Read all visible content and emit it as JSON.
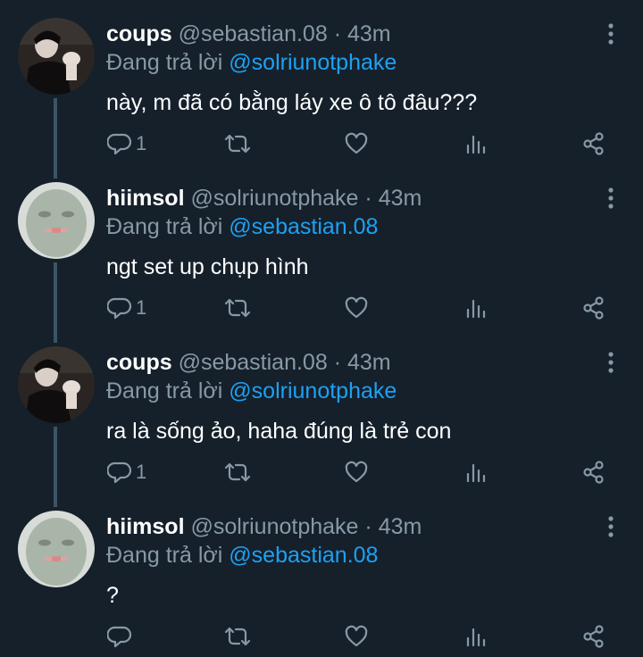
{
  "tweets": [
    {
      "name": "coups",
      "handle": "@sebastian.08",
      "separator": "·",
      "time": "43m",
      "reply_prefix": "Đang trả lời",
      "reply_to": "@solriunotphake",
      "text": "này, m đã có bằng láy xe ô tô đâu???",
      "reply_count": "1",
      "avatar": "coups-avatar"
    },
    {
      "name": "hiimsol",
      "handle": "@solriunotphake",
      "separator": "·",
      "time": "43m",
      "reply_prefix": "Đang trả lời",
      "reply_to": "@sebastian.08",
      "text": "ngt set up chụp hình",
      "reply_count": "1",
      "avatar": "hiimsol-avatar"
    },
    {
      "name": "coups",
      "handle": "@sebastian.08",
      "separator": "·",
      "time": "43m",
      "reply_prefix": "Đang trả lời",
      "reply_to": "@solriunotphake",
      "text": "ra là sống ảo, haha đúng là trẻ con",
      "reply_count": "1",
      "avatar": "coups-avatar"
    },
    {
      "name": "hiimsol",
      "handle": "@solriunotphake",
      "separator": "·",
      "time": "43m",
      "reply_prefix": "Đang trả lời",
      "reply_to": "@sebastian.08",
      "text": "?",
      "reply_count": "",
      "avatar": "hiimsol-avatar"
    }
  ],
  "icons": {
    "reply": "reply-icon",
    "retweet": "retweet-icon",
    "like": "like-icon",
    "stats": "stats-icon",
    "share": "share-icon",
    "menu": "more-options-icon"
  },
  "colors": {
    "background": "#15202b",
    "secondary_text": "#8899a6",
    "mention": "#1da1f2",
    "thread_line": "#3d5466"
  }
}
